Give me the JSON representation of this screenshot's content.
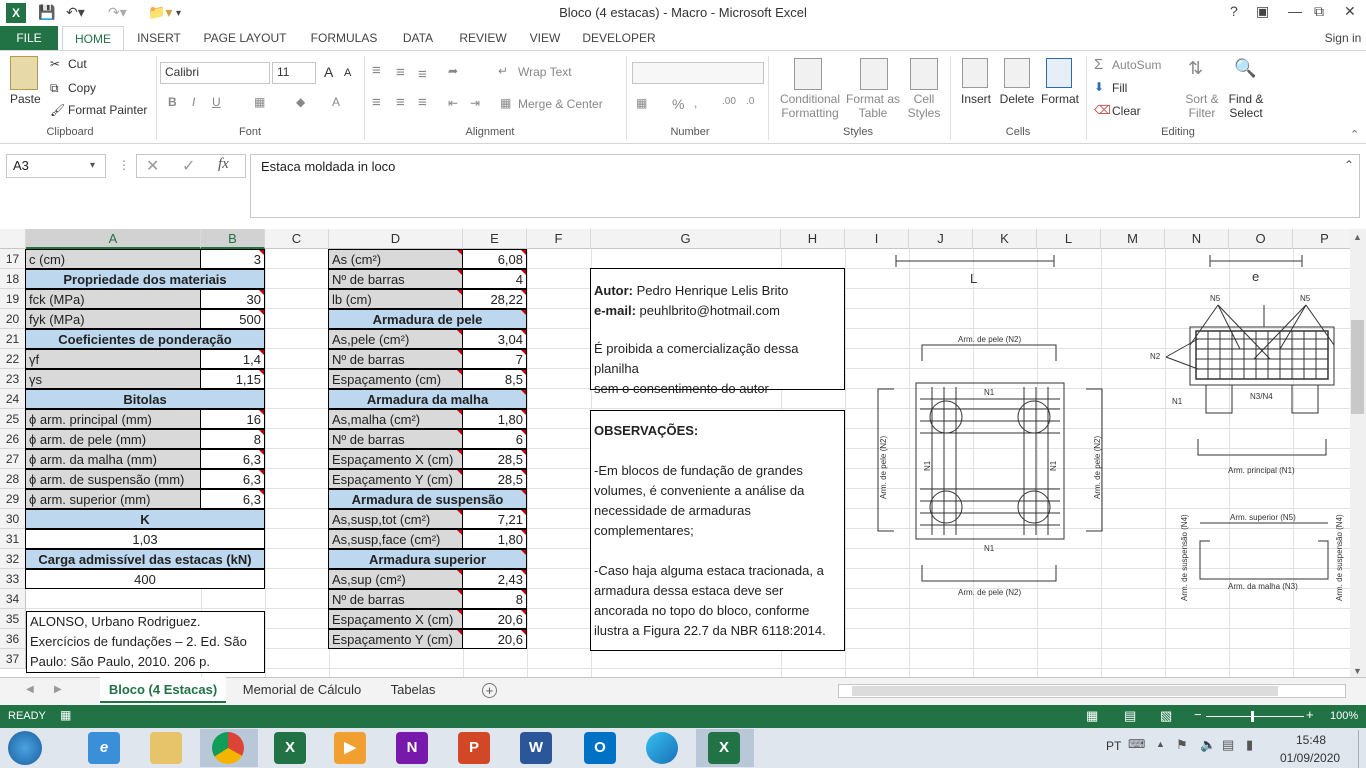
{
  "window": {
    "title": "Bloco (4 estacas) - Macro - Microsoft Excel",
    "help": "?",
    "signin": "Sign in"
  },
  "tabs": [
    "FILE",
    "HOME",
    "INSERT",
    "PAGE LAYOUT",
    "FORMULAS",
    "DATA",
    "REVIEW",
    "VIEW",
    "DEVELOPER"
  ],
  "ribbon": {
    "clipboard": {
      "paste": "Paste",
      "cut": "Cut",
      "copy": "Copy",
      "format_painter": "Format Painter",
      "label": "Clipboard"
    },
    "font": {
      "name": "Calibri",
      "size": "11",
      "bold": "B",
      "italic": "I",
      "underline": "U",
      "grow": "A",
      "shrink": "A",
      "label": "Font"
    },
    "alignment": {
      "wrap": "Wrap Text",
      "merge": "Merge & Center",
      "label": "Alignment"
    },
    "number": {
      "format": "",
      "percent": "%",
      "label": "Number"
    },
    "styles": {
      "cond1": "Conditional",
      "cond2": "Formatting",
      "fmt1": "Format as",
      "fmt2": "Table",
      "cell1": "Cell",
      "cell2": "Styles",
      "label": "Styles"
    },
    "cells": {
      "insert": "Insert",
      "delete": "Delete",
      "format": "Format",
      "label": "Cells"
    },
    "editing": {
      "autosum": "AutoSum",
      "fill": "Fill",
      "clear": "Clear",
      "sort1": "Sort &",
      "sort2": "Filter",
      "find1": "Find &",
      "find2": "Select",
      "label": "Editing"
    }
  },
  "formula_bar": {
    "name_box": "A3",
    "fx": "fx",
    "value": "Estaca moldada in loco"
  },
  "columns": [
    "A",
    "B",
    "C",
    "D",
    "E",
    "F",
    "G",
    "H",
    "I",
    "J",
    "K",
    "L",
    "M",
    "N",
    "O",
    "P"
  ],
  "rows": [
    "17",
    "18",
    "19",
    "20",
    "21",
    "22",
    "23",
    "24",
    "25",
    "26",
    "27",
    "28",
    "29",
    "30",
    "31",
    "32",
    "33",
    "34",
    "35",
    "36",
    "37"
  ],
  "left_table": [
    {
      "a": "c (cm)",
      "b": "3"
    },
    {
      "h": "Propriedade dos materiais"
    },
    {
      "a": "fck (MPa)",
      "b": "30"
    },
    {
      "a": "fyk (MPa)",
      "b": "500"
    },
    {
      "h": "Coeficientes de ponderação"
    },
    {
      "a": "γf",
      "b": "1,4"
    },
    {
      "a": "γs",
      "b": "1,15"
    },
    {
      "h": "Bitolas"
    },
    {
      "a": "ϕ arm. principal (mm)",
      "b": "16"
    },
    {
      "a": "ϕ arm. de pele (mm)",
      "b": "8"
    },
    {
      "a": "ϕ arm. da malha (mm)",
      "b": "6,3"
    },
    {
      "a": "ϕ arm. de suspensão (mm)",
      "b": "6,3"
    },
    {
      "a": "ϕ arm. superior (mm)",
      "b": "6,3"
    },
    {
      "h": "K"
    },
    {
      "c": "1,03"
    },
    {
      "h": "Carga admissível das estacas (kN)"
    },
    {
      "c": "400"
    }
  ],
  "reference": [
    "ALONSO, Urbano Rodriguez.",
    "Exercícios de fundações – 2. Ed. São",
    "Paulo: São Paulo, 2010. 206 p."
  ],
  "right_table": [
    {
      "d": "As (cm²)",
      "e": "6,08"
    },
    {
      "d": "Nº de barras",
      "e": "4"
    },
    {
      "d": "lb (cm)",
      "e": "28,22"
    },
    {
      "h": "Armadura de pele"
    },
    {
      "d": "As,pele (cm²)",
      "e": "3,04"
    },
    {
      "d": "Nº de barras",
      "e": "7"
    },
    {
      "d": "Espaçamento (cm)",
      "e": "8,5"
    },
    {
      "h": "Armadura da malha"
    },
    {
      "d": "As,malha (cm²)",
      "e": "1,80"
    },
    {
      "d": "Nº de barras",
      "e": "6"
    },
    {
      "d": "Espaçamento X (cm)",
      "e": "28,5"
    },
    {
      "d": "Espaçamento Y (cm)",
      "e": "28,5"
    },
    {
      "h": "Armadura de suspensão"
    },
    {
      "d": "As,susp,tot (cm²)",
      "e": "7,21"
    },
    {
      "d": "As,susp,face (cm²)",
      "e": "1,80"
    },
    {
      "h": "Armadura superior"
    },
    {
      "d": "As,sup (cm²)",
      "e": "2,43"
    },
    {
      "d": "Nº de barras",
      "e": "8"
    },
    {
      "d": "Espaçamento X (cm)",
      "e": "20,6"
    },
    {
      "d": "Espaçamento Y (cm)",
      "e": "20,6"
    }
  ],
  "author": {
    "autor_label": "Autor:",
    "autor": "Pedro Henrique Lelis Brito",
    "email_label": "e-mail:",
    "email": "peuhlbrito@hotmail.com",
    "note1": "É proibida a comercialização dessa planilha",
    "note2": "sem o consentimento do autor"
  },
  "obs": {
    "title": "OBSERVAÇÕES:",
    "lines": [
      "-Em blocos de fundação de grandes",
      "volumes, é conveniente a análise da",
      "necessidade de armaduras",
      "complementares;",
      "",
      "-Caso haja alguma estaca tracionada, a",
      "armadura dessa estaca deve ser",
      "ancorada no topo do bloco, conforme",
      "ilustra a Figura 22.7 da NBR 6118:2014."
    ]
  },
  "drawing": {
    "L": "L",
    "e": "e",
    "pele_top": "Arm. de pele (N2)",
    "pele_bottom": "Arm. de pele (N2)",
    "pele_left": "Arm. de pele (N2)",
    "pele_right": "Arm. de pele (N2)",
    "n1": "N1",
    "n2": "N2",
    "n5": "N5",
    "n34": "N3/N4",
    "principal": "Arm. principal (N1)",
    "superior": "Arm. superior (N5)",
    "malha": "Arm. da malha (N3)",
    "susp": "Arm. de suspensão (N4)"
  },
  "sheets": [
    "Bloco (4 Estacas)",
    "Memorial de Cálculo",
    "Tabelas"
  ],
  "status": {
    "ready": "READY",
    "zoom": "100%"
  },
  "taskbar": {
    "lang": "PT",
    "time": "15:48",
    "date": "01/09/2020"
  }
}
